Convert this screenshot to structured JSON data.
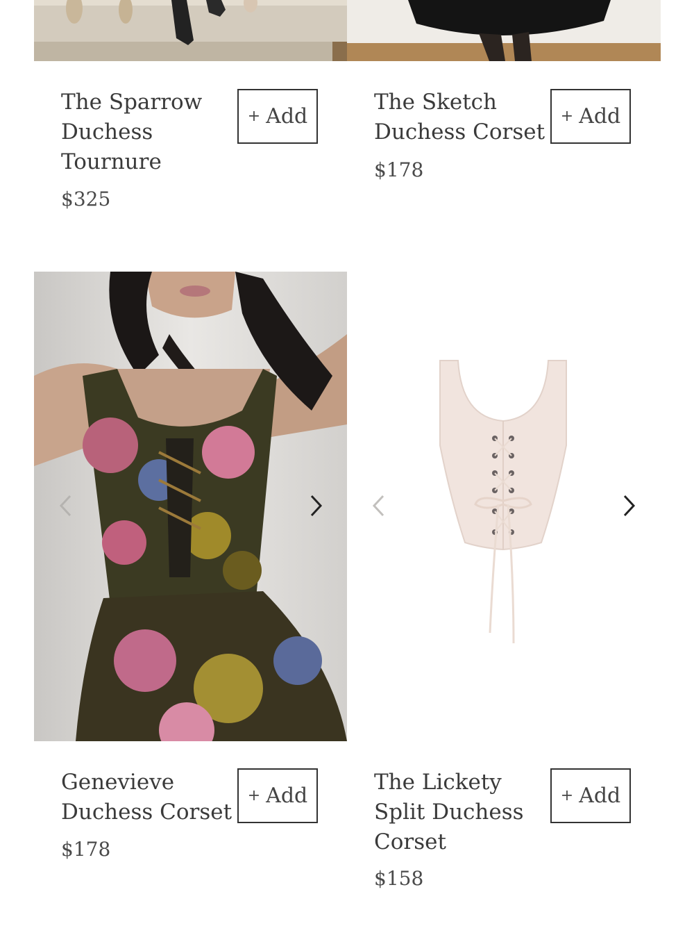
{
  "products": [
    {
      "title_lines": [
        "The Sparrow",
        "Duchess",
        "Tournure"
      ],
      "price": "$325",
      "add_label": "Add",
      "add_symbol": "+"
    },
    {
      "title_lines": [
        "The Sketch",
        "Duchess Corset"
      ],
      "price": "$178",
      "add_label": "Add",
      "add_symbol": "+"
    },
    {
      "title_lines": [
        "Genevieve",
        "Duchess Corset"
      ],
      "price": "$178",
      "add_label": "Add",
      "add_symbol": "+"
    },
    {
      "title_lines": [
        "The Lickety",
        "Split Duchess",
        "Corset"
      ],
      "price": "$158",
      "add_label": "Add",
      "add_symbol": "+"
    }
  ],
  "icons": {
    "prev": "chevron-left-icon",
    "next": "chevron-right-icon"
  },
  "colors": {
    "text": "#3a3a3a",
    "button_border": "#333333",
    "background": "#ffffff"
  }
}
